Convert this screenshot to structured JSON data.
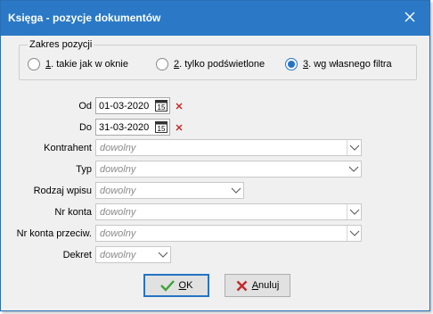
{
  "window": {
    "title": "Księga - pozycje dokumentów",
    "close_icon": "close-icon"
  },
  "scope": {
    "legend": "Zakres pozycji",
    "options": [
      {
        "num": "1",
        "rest": ". takie jak w oknie",
        "selected": false
      },
      {
        "num": "2",
        "rest": ". tylko podświetlone",
        "selected": false
      },
      {
        "num": "3",
        "rest": ". wg własnego filtra",
        "selected": true
      }
    ]
  },
  "dates": {
    "from_label": "Od",
    "from_value": "01-03-2020",
    "to_label": "Do",
    "to_value": "31-03-2020",
    "calendar_icon_text": "15"
  },
  "fields": {
    "kontrahent": {
      "label": "Kontrahent",
      "value": "dowolny"
    },
    "typ": {
      "label": "Typ",
      "value": "dowolny"
    },
    "rodzaj_wpisu": {
      "label": "Rodzaj wpisu",
      "value": "dowolny"
    },
    "nr_konta": {
      "label": "Nr konta",
      "value": "dowolny"
    },
    "nr_konta_przeciw": {
      "label": "Nr konta przeciw.",
      "value": "dowolny"
    },
    "dekret": {
      "label": "Dekret",
      "value": "dowolny"
    }
  },
  "buttons": {
    "ok_underlined": "O",
    "ok_rest": "K",
    "cancel_underlined": "A",
    "cancel_rest": "nuluj"
  },
  "colors": {
    "titlebar": "#2b79c6",
    "accent": "#2574c6",
    "clear_x": "#cc2020",
    "ok_check": "#3aa23a",
    "cancel_x": "#c62828"
  }
}
